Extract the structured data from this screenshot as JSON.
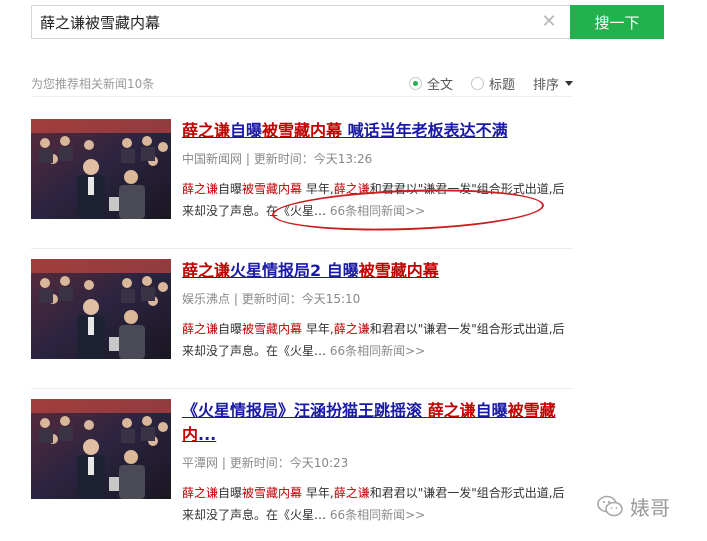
{
  "search": {
    "query": "薛之谦被雪藏内幕",
    "button_label": "搜一下",
    "clear_icon": "close-icon"
  },
  "filters": {
    "recommend_text": "为您推荐相关新闻10条",
    "opt_full": "全文",
    "opt_title": "标题",
    "selected": "全文",
    "sort_label": "排序"
  },
  "results": [
    {
      "title_parts": [
        {
          "t": "薛之谦",
          "hl": true
        },
        {
          "t": "自曝",
          "hl": false
        },
        {
          "t": "被雪藏内幕",
          "hl": true
        },
        {
          "t": " 喊话当年老板表达不满",
          "hl": false
        }
      ],
      "source": "中国新闻网",
      "time": "更新时间：今天13:26",
      "snippet_parts": [
        {
          "t": "薛之谦",
          "hl": true
        },
        {
          "t": "自曝",
          "hl": false
        },
        {
          "t": "被雪藏内幕",
          "hl": true
        },
        {
          "t": " 早年,",
          "hl": false
        },
        {
          "t": "薛之谦",
          "hl": true
        },
        {
          "t": "和君君以\"谦君一发\"组合形式出道,后来却没了声息。在《火星… ",
          "hl": false
        }
      ],
      "more": "66条相同新闻>>"
    },
    {
      "title_parts": [
        {
          "t": "薛之谦",
          "hl": true
        },
        {
          "t": "火星情报局2 自曝",
          "hl": false
        },
        {
          "t": "被雪藏内幕",
          "hl": true
        }
      ],
      "source": "娱乐沸点",
      "time": "更新时间：今天15:10",
      "snippet_parts": [
        {
          "t": "薛之谦",
          "hl": true
        },
        {
          "t": "自曝",
          "hl": false
        },
        {
          "t": "被雪藏内幕",
          "hl": true
        },
        {
          "t": " 早年,",
          "hl": false
        },
        {
          "t": "薛之谦",
          "hl": true
        },
        {
          "t": "和君君以\"谦君一发\"组合形式出道,后来却没了声息。在《火星… ",
          "hl": false
        }
      ],
      "more": "66条相同新闻>>"
    },
    {
      "title_parts": [
        {
          "t": "《火星情报局》汪涵扮猫王跳摇滚 ",
          "hl": false
        },
        {
          "t": "薛之谦",
          "hl": true
        },
        {
          "t": "自曝",
          "hl": false
        },
        {
          "t": "被雪藏内",
          "hl": true
        },
        {
          "t": "...",
          "hl": false
        }
      ],
      "source": "平潭网",
      "time": "更新时间：今天10:23",
      "snippet_parts": [
        {
          "t": "薛之谦",
          "hl": true
        },
        {
          "t": "自曝",
          "hl": false
        },
        {
          "t": "被雪藏内幕",
          "hl": true
        },
        {
          "t": " 早年,",
          "hl": false
        },
        {
          "t": "薛之谦",
          "hl": true
        },
        {
          "t": "和君君以\"谦君一发\"组合形式出道,后来却没了声息。在《火星… ",
          "hl": false
        }
      ],
      "more": "66条相同新闻>>"
    }
  ],
  "watermark": {
    "text": "婊哥",
    "icon": "wechat-icon"
  },
  "colors": {
    "accent": "#22b14c",
    "title_link": "#1a1aa6",
    "highlight": "#c00000",
    "annotation": "#c8201e"
  }
}
